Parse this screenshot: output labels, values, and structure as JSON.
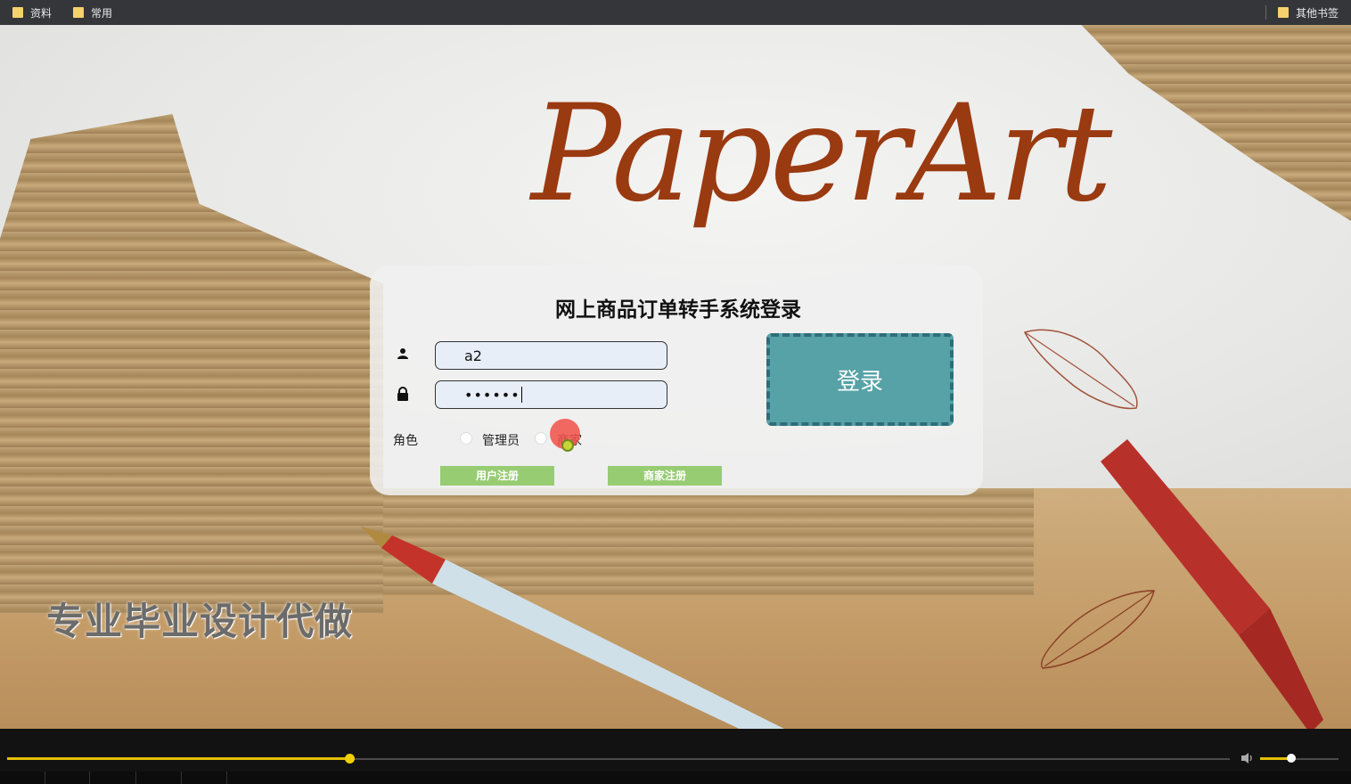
{
  "bookmarks": {
    "left": [
      {
        "label": "资料"
      },
      {
        "label": "常用"
      }
    ],
    "right": {
      "label": "其他书签"
    }
  },
  "page": {
    "logo_text": "PaperArt",
    "watermark": "专业毕业设计代做"
  },
  "login": {
    "title": "网上商品订单转手系统登录",
    "username_value": "a2",
    "password_value": "••••••",
    "role_label": "角色",
    "roles": [
      {
        "label": "管理员",
        "selected": false
      },
      {
        "label": "商家",
        "selected": false
      }
    ],
    "login_button": "登录",
    "user_register": "用户注册",
    "merchant_register": "商家注册"
  },
  "player": {
    "progress": 0.28,
    "volume": 0.4
  },
  "colors": {
    "logo": "#9a3a10",
    "login_button": "#56a2a7",
    "register_button": "#97cc73",
    "progress": "#e2c000"
  }
}
